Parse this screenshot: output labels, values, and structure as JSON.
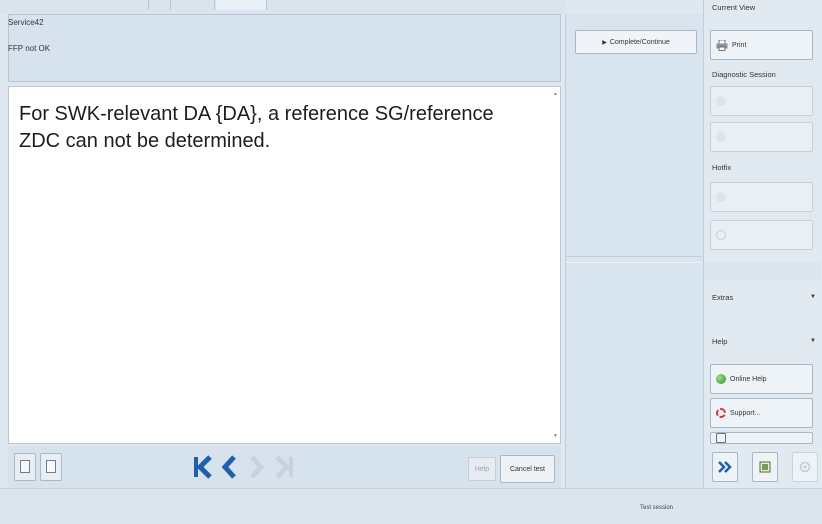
{
  "header": {
    "title": "Service42",
    "subtitle": "FFP not OK"
  },
  "message": {
    "text": "For SWK-relevant DA {DA}, a reference SG/reference ZDC can not be determined."
  },
  "middle": {
    "complete_label": "Complete/Continue"
  },
  "right_panel": {
    "current_view_label": "Current View",
    "print_label": "Print",
    "diagnostic_session_label": "Diagnostic Session",
    "hotfix_label": "Hotfix",
    "extras_label": "Extras",
    "help_label": "Help",
    "online_help_label": "Online Help",
    "support_label": "Support..."
  },
  "bottom_bar": {
    "help_label": "Help",
    "cancel_label": "Cancel test"
  },
  "status": {
    "test_session": "Test session"
  },
  "colors": {
    "accent_blue": "#1f5fb0",
    "nav_disabled": "#c7d2dd"
  },
  "icons": {
    "print": "printer-icon",
    "online_help": "globe-icon",
    "support": "support-icon",
    "forward": "double-chevron-right-icon",
    "dock": "dock-icon",
    "settings": "gear-icon",
    "nav_first": "first-page-icon",
    "nav_prev": "previous-icon",
    "nav_next": "next-icon",
    "nav_last": "last-page-icon"
  }
}
